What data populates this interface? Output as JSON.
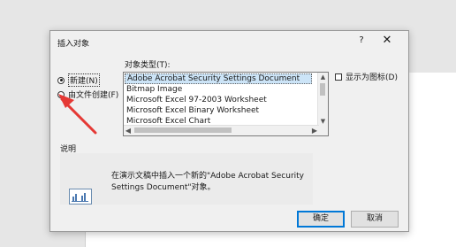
{
  "dialog": {
    "title": "插入对象",
    "help_label": "?",
    "close_label": "✕"
  },
  "options": {
    "create_new": "新建(N)",
    "create_from_file": "由文件创建(F)"
  },
  "object_type": {
    "label": "对象类型(T):",
    "items": [
      "Adobe Acrobat Security Settings Document",
      "Bitmap Image",
      "Microsoft Excel 97-2003 Worksheet",
      "Microsoft Excel Binary Worksheet",
      "Microsoft Excel Chart"
    ],
    "selected_index": 0
  },
  "display_as_icon": {
    "label": "显示为图标(D)",
    "checked": false
  },
  "result": {
    "label": "说明",
    "text": "在演示文稿中插入一个新的\"Adobe Acrobat Security Settings Document\"对象。"
  },
  "buttons": {
    "ok": "确定",
    "cancel": "取消"
  },
  "colors": {
    "annotation_arrow": "#e53935",
    "selection": "#cce4f7",
    "ok_border": "#0078d7"
  }
}
